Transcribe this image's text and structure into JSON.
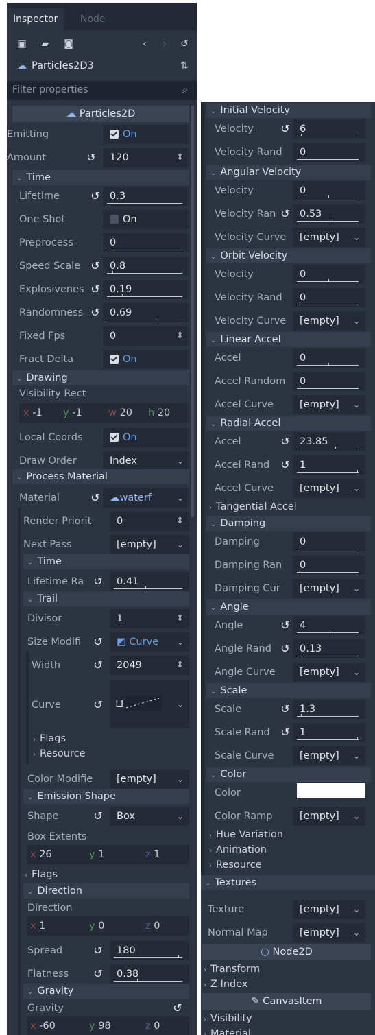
{
  "tabs": {
    "inspector": "Inspector",
    "node": "Node"
  },
  "toolbar": {
    "icons": [
      "new-resource-icon",
      "open-icon",
      "save-icon",
      "history-back-icon",
      "history-forward-icon",
      "object-menu-icon"
    ],
    "node_name": "Particles2D3",
    "filter_placeholder": "Filter properties"
  },
  "left": {
    "section_header": "Particles2D",
    "emitting": {
      "label": "Emitting",
      "value": "On"
    },
    "amount": {
      "label": "Amount",
      "value": "120"
    },
    "time_section": "Time",
    "lifetime": {
      "label": "Lifetime",
      "value": "0.3"
    },
    "one_shot": {
      "label": "One Shot",
      "value": "On"
    },
    "preprocess": {
      "label": "Preprocess",
      "value": "0"
    },
    "speed_scale": {
      "label": "Speed Scale",
      "value": "0.8"
    },
    "explosiveness": {
      "label": "Explosivenes",
      "value": "0.19"
    },
    "randomness": {
      "label": "Randomness",
      "value": "0.69"
    },
    "fixed_fps": {
      "label": "Fixed Fps",
      "value": "0"
    },
    "fract_delta": {
      "label": "Fract Delta",
      "value": "On"
    },
    "drawing_section": "Drawing",
    "visibility_rect": {
      "label": "Visibility Rect",
      "x": "-1",
      "y": "-1",
      "w": "20",
      "h": "20"
    },
    "local_coords": {
      "label": "Local Coords",
      "value": "On"
    },
    "draw_order": {
      "label": "Draw Order",
      "value": "Index"
    },
    "process_material_section": "Process Material",
    "material": {
      "label": "Material",
      "value": "waterf"
    },
    "render_priority": {
      "label": "Render Priorit",
      "value": "0"
    },
    "next_pass": {
      "label": "Next Pass",
      "value": "[empty]"
    },
    "pm_time_section": "Time",
    "lifetime_random": {
      "label": "Lifetime Ra",
      "value": "0.41"
    },
    "trail_section": "Trail",
    "divisor": {
      "label": "Divisor",
      "value": "1"
    },
    "size_modifier": {
      "label": "Size Modifi",
      "value": "Curve"
    },
    "width": {
      "label": "Width",
      "value": "2049"
    },
    "curve": {
      "label": "Curve"
    },
    "flags_sub": "Flags",
    "resource_sub": "Resource",
    "color_modifier": {
      "label": "Color Modifie",
      "value": "[empty]"
    },
    "emission_shape_section": "Emission Shape",
    "shape": {
      "label": "Shape",
      "value": "Box"
    },
    "box_extents": {
      "label": "Box Extents",
      "x": "26",
      "y": "1",
      "z": "1"
    },
    "flags_section": "Flags",
    "direction_section": "Direction",
    "direction": {
      "label": "Direction",
      "x": "1",
      "y": "0",
      "z": "0"
    },
    "spread": {
      "label": "Spread",
      "value": "180"
    },
    "flatness": {
      "label": "Flatness",
      "value": "0.38"
    },
    "gravity_section": "Gravity",
    "gravity": {
      "label": "Gravity",
      "x": "-60",
      "y": "98",
      "z": "0"
    }
  },
  "right": {
    "initial_velocity_section": "Initial Velocity",
    "iv_velocity": {
      "label": "Velocity",
      "value": "6"
    },
    "iv_velocity_rand": {
      "label": "Velocity Rand",
      "value": "0"
    },
    "angular_velocity_section": "Angular Velocity",
    "av_velocity": {
      "label": "Velocity",
      "value": "0"
    },
    "av_velocity_rand": {
      "label": "Velocity Ran",
      "value": "0.53"
    },
    "av_velocity_curve": {
      "label": "Velocity Curve",
      "value": "[empty]"
    },
    "orbit_velocity_section": "Orbit Velocity",
    "ov_velocity": {
      "label": "Velocity",
      "value": "0"
    },
    "ov_velocity_rand": {
      "label": "Velocity Rand",
      "value": "0"
    },
    "ov_velocity_curve": {
      "label": "Velocity Curve",
      "value": "[empty]"
    },
    "linear_accel_section": "Linear Accel",
    "la_accel": {
      "label": "Accel",
      "value": "0"
    },
    "la_accel_random": {
      "label": "Accel Random",
      "value": "0"
    },
    "la_accel_curve": {
      "label": "Accel Curve",
      "value": "[empty]"
    },
    "radial_accel_section": "Radial Accel",
    "ra_accel": {
      "label": "Accel",
      "value": "23.85"
    },
    "ra_accel_rand": {
      "label": "Accel Rand",
      "value": "1"
    },
    "ra_accel_curve": {
      "label": "Accel Curve",
      "value": "[empty]"
    },
    "tangential_accel_section": "Tangential Accel",
    "damping_section": "Damping",
    "damping": {
      "label": "Damping",
      "value": "0"
    },
    "damping_random": {
      "label": "Damping Ran",
      "value": "0"
    },
    "damping_curve": {
      "label": "Damping Cur",
      "value": "[empty]"
    },
    "angle_section": "Angle",
    "angle": {
      "label": "Angle",
      "value": "4"
    },
    "angle_rand": {
      "label": "Angle Rand",
      "value": "0.13"
    },
    "angle_curve": {
      "label": "Angle Curve",
      "value": "[empty]"
    },
    "scale_section": "Scale",
    "scale": {
      "label": "Scale",
      "value": "1.3"
    },
    "scale_rand": {
      "label": "Scale Rand",
      "value": "1"
    },
    "scale_curve": {
      "label": "Scale Curve",
      "value": "[empty]"
    },
    "color_section": "Color",
    "color": {
      "label": "Color",
      "value_hex": "#ffffff"
    },
    "color_ramp": {
      "label": "Color Ramp",
      "value": "[empty]"
    },
    "hue_variation_sub": "Hue Variation",
    "animation_sub": "Animation",
    "resource_sub": "Resource",
    "textures_section": "Textures",
    "texture": {
      "label": "Texture",
      "value": "[empty]"
    },
    "normal_map": {
      "label": "Normal Map",
      "value": "[empty]"
    },
    "node2d_header": "Node2D",
    "transform_section": "Transform",
    "z_index_section": "Z Index",
    "canvasitem_header": "CanvasItem",
    "visibility_section": "Visibility",
    "material_section": "Material"
  },
  "colors": {
    "panel": "#2c3442",
    "field": "#242b36",
    "section": "#353e4e",
    "accent": "#699ce8",
    "x_axis": "#e0646a",
    "y_axis": "#7fd67e",
    "z_axis": "#6f8ee6"
  }
}
